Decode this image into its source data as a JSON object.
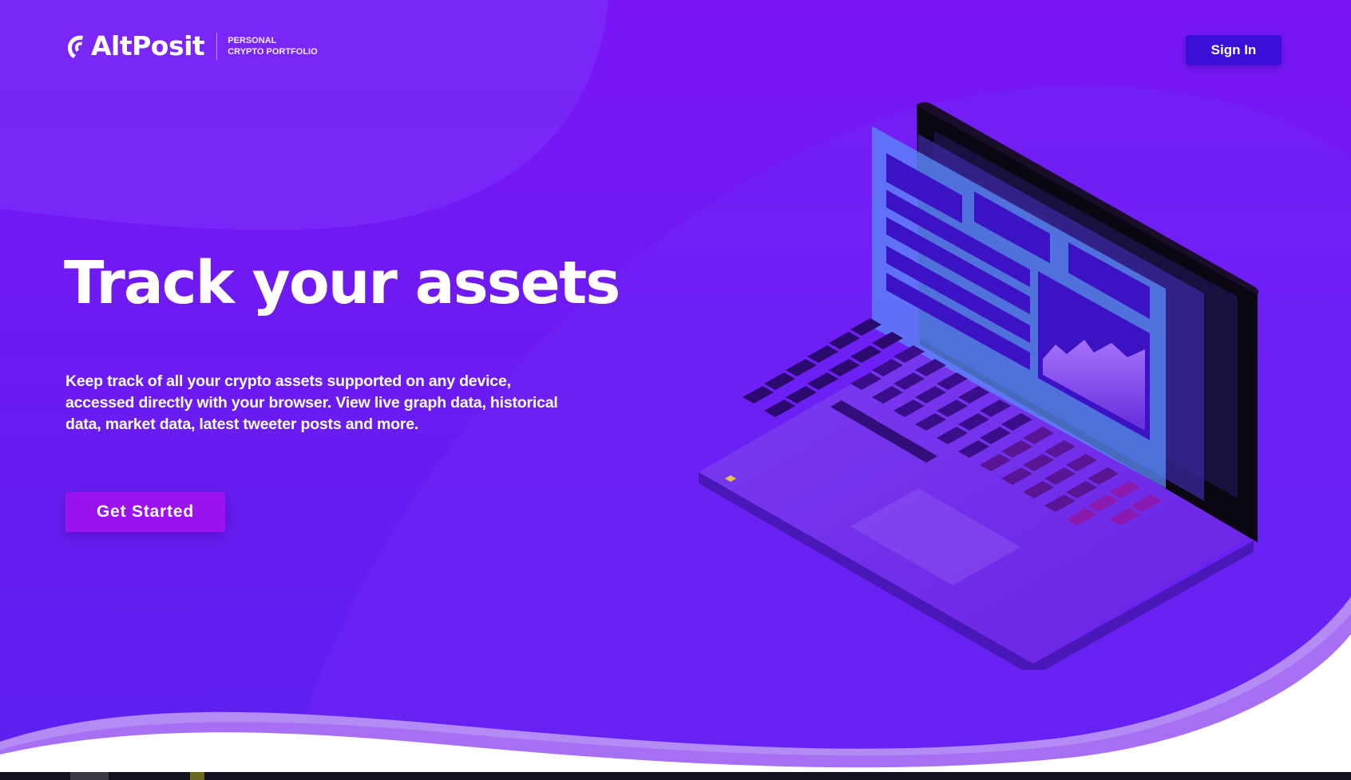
{
  "brand": {
    "name": "AltPosit",
    "tagline_line1": "PERSONAL",
    "tagline_line2": "CRYPTO PORTFOLIO"
  },
  "header": {
    "signin_label": "Sign In"
  },
  "hero": {
    "headline": "Track your assets",
    "description": "Keep track of all your crypto assets supported on any device, accessed directly with your browser. View live graph data, historical data, market data, latest tweeter posts and more.",
    "cta_label": "Get Started"
  },
  "colors": {
    "background_top": "#7b1cf6",
    "background_bottom": "#5a1ff0",
    "signin_button": "#3a0fd8",
    "cta_button": "#9a12ee",
    "wave_light": "#b48af5"
  },
  "illustration": {
    "icon": "laptop-dashboard-illustration"
  }
}
